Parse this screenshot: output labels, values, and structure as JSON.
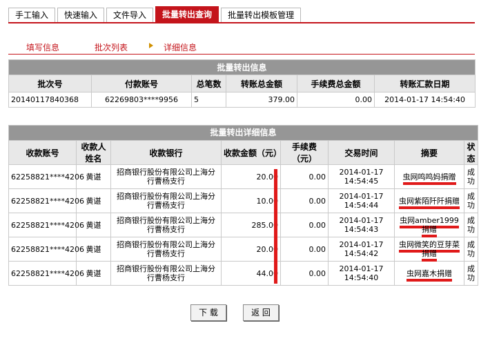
{
  "tabs": [
    {
      "label": "手工输入",
      "active": false
    },
    {
      "label": "快速输入",
      "active": false
    },
    {
      "label": "文件导入",
      "active": false
    },
    {
      "label": "批量转出查询",
      "active": true
    },
    {
      "label": "批量转出模板管理",
      "active": false
    }
  ],
  "breadcrumb": {
    "step1": "填写信息",
    "step2": "批次列表",
    "step3": "详细信息"
  },
  "batch_info": {
    "title": "批量转出信息",
    "headers": [
      "批次号",
      "付款账号",
      "总笔数",
      "转账总金额",
      "手续费总金额",
      "转账汇款日期"
    ],
    "row": {
      "batch_no": "20140117840368",
      "payer_account": "62269803****9956",
      "count": "5",
      "total": "379.00",
      "fee_total": "0.00",
      "date": "2014-01-17  14:54:40"
    }
  },
  "detail": {
    "title": "批量转出详细信息",
    "headers": [
      "收款账号",
      "收款人姓名",
      "收款银行",
      "收款金额（元）",
      "手续费（元）",
      "交易时间",
      "摘要",
      "状态"
    ],
    "rows": [
      {
        "account": "62258821****4206",
        "name": "黄谌",
        "bank": "招商银行股份有限公司上海分行曹杨支行",
        "amount": "20.00",
        "fee": "0.00",
        "date": "2014-01-17",
        "time": "14:54:45",
        "memo": "虫网鸣鸣妈捐赠",
        "status": "成功"
      },
      {
        "account": "62258821****4206",
        "name": "黄谌",
        "bank": "招商银行股份有限公司上海分行曹杨支行",
        "amount": "10.00",
        "fee": "0.00",
        "date": "2014-01-17",
        "time": "14:54:44",
        "memo": "虫网紫陌阡阡捐赠",
        "status": "成功"
      },
      {
        "account": "62258821****4206",
        "name": "黄谌",
        "bank": "招商银行股份有限公司上海分行曹杨支行",
        "amount": "285.00",
        "fee": "0.00",
        "date": "2014-01-17",
        "time": "14:54:43",
        "memo": "虫网amber1999捐赠",
        "status": "成功"
      },
      {
        "account": "62258821****4206",
        "name": "黄谌",
        "bank": "招商银行股份有限公司上海分行曹杨支行",
        "amount": "20.00",
        "fee": "0.00",
        "date": "2014-01-17",
        "time": "14:54:42",
        "memo": "虫网微笑的豆芽菜捐赠",
        "status": "成功"
      },
      {
        "account": "62258821****4206",
        "name": "黄谌",
        "bank": "招商银行股份有限公司上海分行曹杨支行",
        "amount": "44.00",
        "fee": "0.00",
        "date": "2014-01-17",
        "time": "14:54:40",
        "memo": "虫网嘉木捐赠",
        "status": "成功"
      }
    ]
  },
  "buttons": {
    "download": "下 载",
    "back": "返 回"
  },
  "colors": {
    "accent": "#c4141b",
    "header_bar": "#969696",
    "annotation": "#e01a1a"
  }
}
